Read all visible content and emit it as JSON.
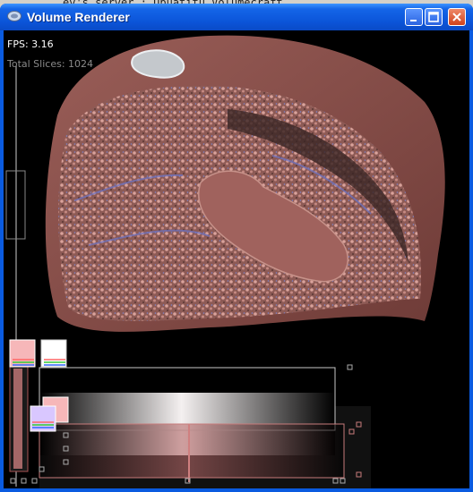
{
  "background_text": "ev's server : Ubuatitu Volumecraft",
  "window": {
    "title": "Volume Renderer",
    "controls": {
      "minimize": "minimize",
      "maximize": "maximize",
      "close": "close"
    }
  },
  "hud": {
    "fps": "FPS: 3.16",
    "total_slices": "Total Slices: 1024"
  },
  "transfer_function": {
    "gradient_stops": [
      "#000000",
      "#ffffff",
      "#000000"
    ],
    "highlight_color": "#f6b7b9",
    "widget_color": "#d9c7ff",
    "accent_colors": [
      "#ff6666",
      "#33cc33",
      "#3366ff"
    ]
  },
  "render": {
    "tissue_color": "#b97b75",
    "vessel_color": "#6b73c8"
  }
}
